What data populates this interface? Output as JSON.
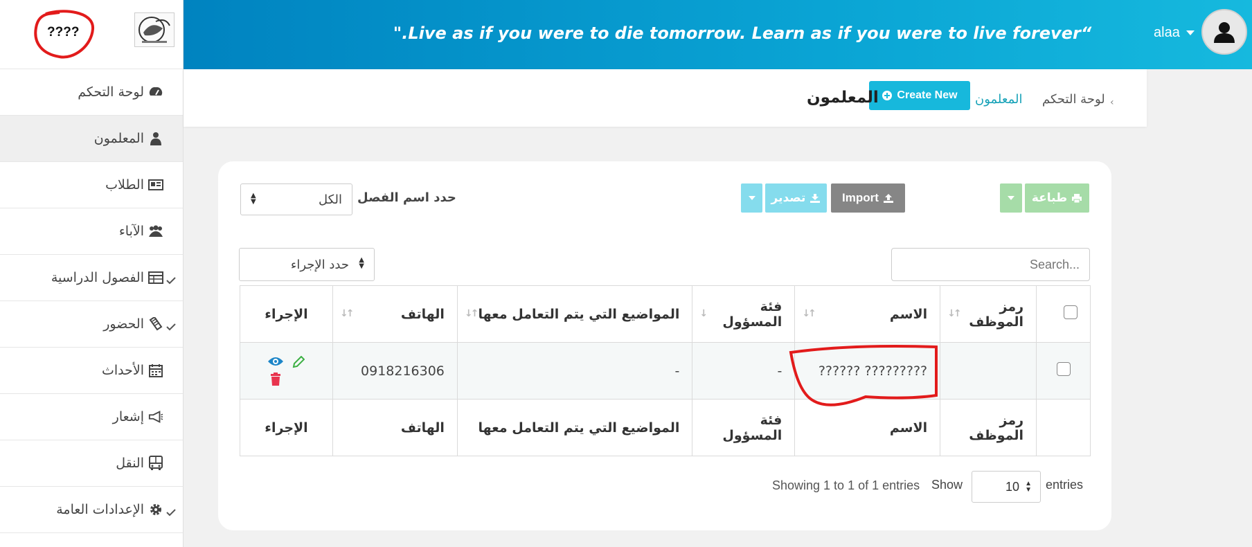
{
  "sidebar": {
    "logo_text": "????",
    "items": [
      {
        "label": "لوحة التحكم",
        "icon": "dashboard-icon"
      },
      {
        "label": "المعلمون",
        "icon": "teacher-icon"
      },
      {
        "label": "الطلاب",
        "icon": "student-card-icon"
      },
      {
        "label": "الآباء",
        "icon": "parents-group-icon"
      },
      {
        "label": "الفصول الدراسية",
        "icon": "table-icon"
      },
      {
        "label": "الحضور",
        "icon": "attendance-icon"
      },
      {
        "label": "الأحداث",
        "icon": "calendar-icon"
      },
      {
        "label": "إشعار",
        "icon": "megaphone-icon"
      },
      {
        "label": "النقل",
        "icon": "bus-icon"
      },
      {
        "label": "الإعدادات العامة",
        "icon": "gear-icon"
      }
    ]
  },
  "header": {
    "quote": "\".Live as if you were to die tomorrow. Learn as if you were to live forever“",
    "user": "alaa"
  },
  "breadcrumb": {
    "home": "لوحة التحكم",
    "current": "المعلمون",
    "create_label": "Create New",
    "page_title": "المعلمون"
  },
  "toolbar": {
    "print_label": "طباعة",
    "import_label": "Import",
    "export_label": "تصدير",
    "class_filter_label": "حدد اسم الفصل",
    "class_filter_value": "الكل",
    "action_select": "حدد الإجراء",
    "search_placeholder": "Search..."
  },
  "table": {
    "columns": [
      "رمز الموظف",
      "الاسم",
      "فئة المسؤول",
      "المواضيع التي يتم التعامل معها",
      "الهاتف",
      "الإجراء"
    ],
    "rows": [
      {
        "code": "",
        "name": "?????? ?????????",
        "category": "-",
        "subjects": "-",
        "phone": "0918216306"
      }
    ]
  },
  "footer": {
    "info": "Showing 1 to 1 of 1 entries",
    "show": "Show",
    "length": "10",
    "entries": "entries"
  },
  "colors": {
    "header_start": "#0083c0",
    "header_end": "#16b9de",
    "create_btn": "#17b8dc",
    "print_btn": "#a6dca8",
    "export_btn": "#85dced",
    "import_btn": "#868686",
    "delete_icon": "#e8344e",
    "edit_icon": "#3cb043",
    "view_icon": "#1d86c8"
  }
}
